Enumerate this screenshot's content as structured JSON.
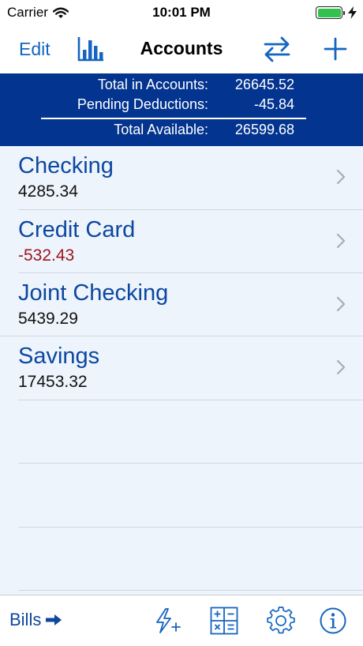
{
  "status_bar": {
    "carrier": "Carrier",
    "time": "10:01 PM",
    "icons": [
      "wifi-icon",
      "battery-icon",
      "charging-bolt-icon"
    ]
  },
  "nav": {
    "edit_label": "Edit",
    "title": "Accounts",
    "icons": [
      "bar-chart-icon",
      "transfer-arrows-icon",
      "plus-icon"
    ]
  },
  "summary": {
    "total_label": "Total in Accounts:",
    "total_value": "26645.52",
    "pending_label": "Pending Deductions:",
    "pending_value": "-45.84",
    "available_label": "Total Available:",
    "available_value": "26599.68"
  },
  "accounts": [
    {
      "name": "Checking",
      "balance": "4285.34"
    },
    {
      "name": "Credit Card",
      "balance": "-532.43"
    },
    {
      "name": "Joint Checking",
      "balance": "5439.29"
    },
    {
      "name": "Savings",
      "balance": "17453.32"
    }
  ],
  "tab_bar": {
    "bills_label": "Bills",
    "icons": [
      "bills-arrow-icon",
      "quick-add-bolt-icon",
      "calculator-icon",
      "gear-icon",
      "info-icon"
    ]
  },
  "colors": {
    "accent": "#1565c0",
    "banner": "#03348f",
    "list_background": "#edf4fc",
    "negative": "#a0141e"
  }
}
